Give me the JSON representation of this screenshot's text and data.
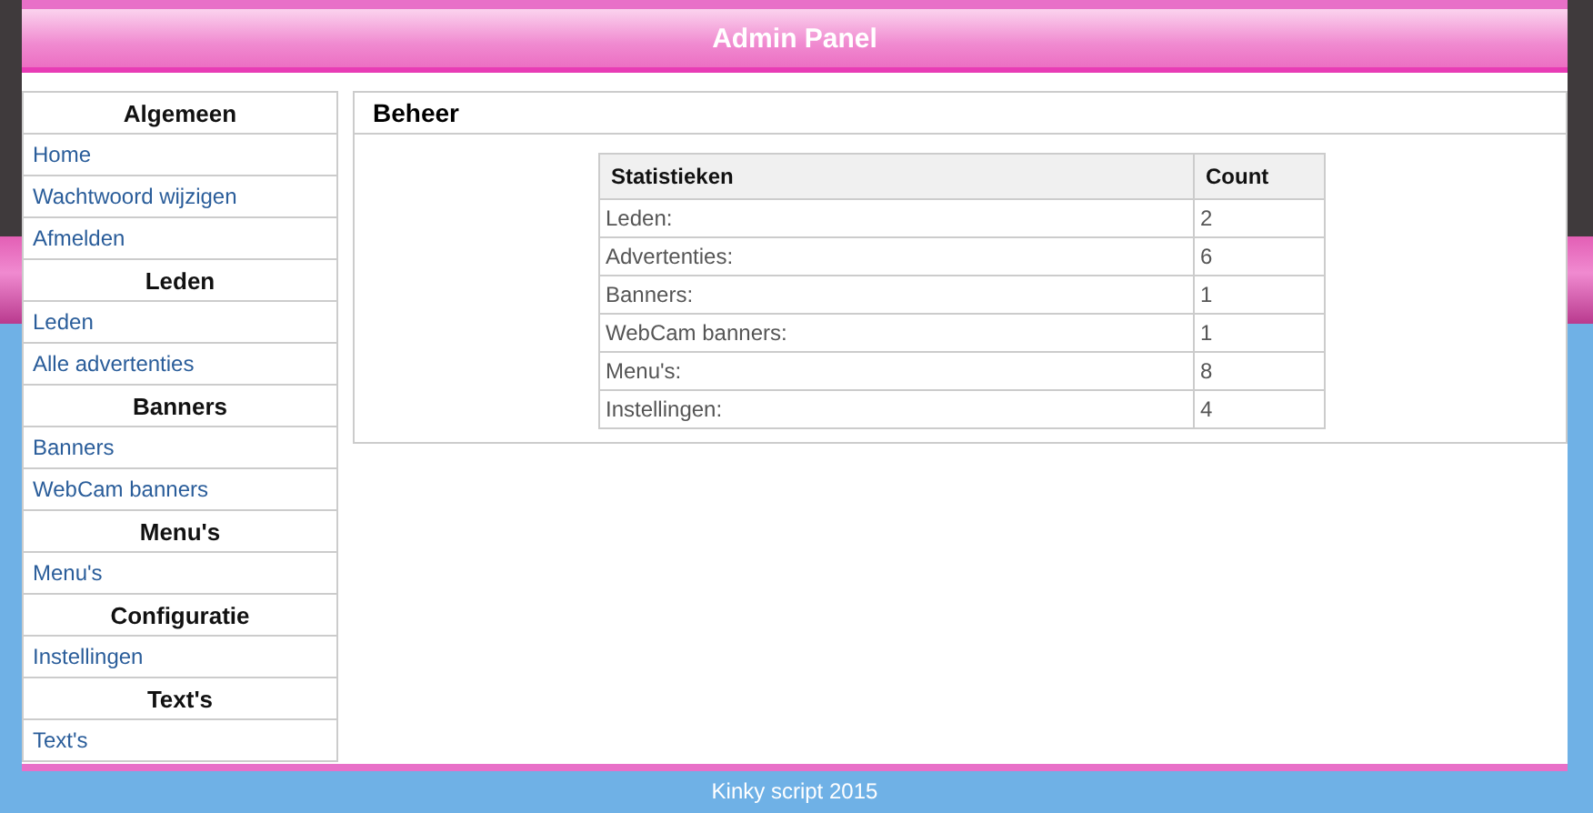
{
  "header": {
    "title": "Admin Panel"
  },
  "sidebar": {
    "sections": [
      {
        "title": "Algemeen",
        "items": [
          "Home",
          "Wachtwoord wijzigen",
          "Afmelden"
        ]
      },
      {
        "title": "Leden",
        "items": [
          "Leden",
          "Alle advertenties"
        ]
      },
      {
        "title": "Banners",
        "items": [
          "Banners",
          "WebCam banners"
        ]
      },
      {
        "title": "Menu's",
        "items": [
          "Menu's"
        ]
      },
      {
        "title": "Configuratie",
        "items": [
          "Instellingen"
        ]
      },
      {
        "title": "Text's",
        "items": [
          "Text's"
        ]
      }
    ]
  },
  "panel": {
    "title": "Beheer",
    "table": {
      "columns": [
        "Statistieken",
        "Count"
      ],
      "rows": [
        [
          "Leden:",
          "2"
        ],
        [
          "Advertenties:",
          "6"
        ],
        [
          "Banners:",
          "1"
        ],
        [
          "WebCam banners:",
          "1"
        ],
        [
          "Menu's:",
          "8"
        ],
        [
          "Instellingen:",
          "4"
        ]
      ]
    }
  },
  "footer": {
    "text": "Kinky script 2015"
  }
}
